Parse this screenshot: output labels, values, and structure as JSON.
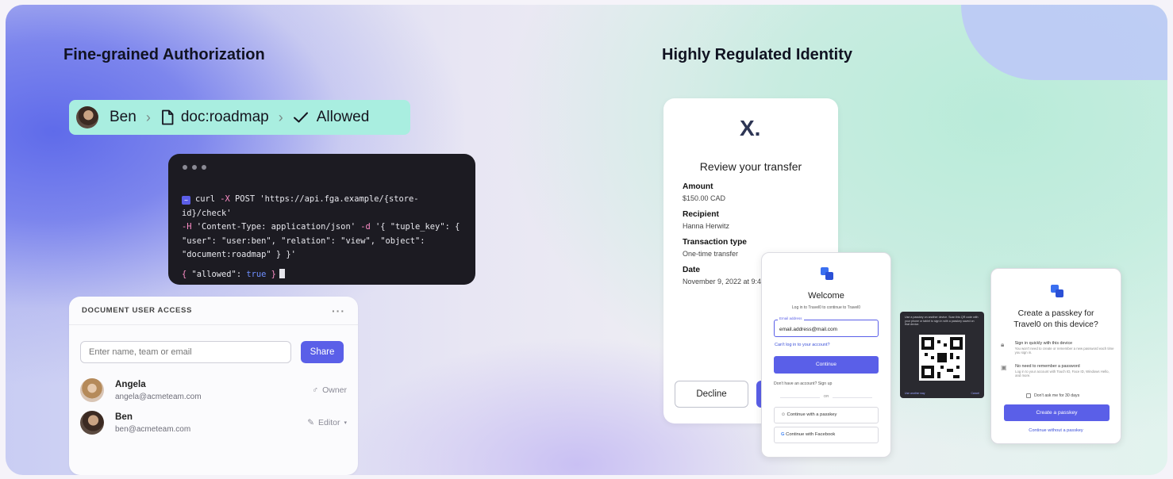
{
  "sections": {
    "left_title": "Fine-grained Authorization",
    "right_title": "Highly Regulated Identity"
  },
  "fga_chip": {
    "user": "Ben",
    "resource": "doc:roadmap",
    "result": "Allowed",
    "bg_color": "#a9eee0"
  },
  "terminal": {
    "prompt_icon": "~",
    "line1_cmd": "curl ",
    "line1_flag": "-X",
    "line1_rest": " POST 'https://api.fga.example/{store-id}/check'",
    "line2_flag": "-H",
    "line2_rest": " 'Content-Type: application/json' ",
    "line2_flag2": "-d",
    "line2_rest2": " '{ \"tuple_key\": {",
    "line3": "\"user\": \"user:ben\", \"relation\": \"view\", \"object\":",
    "line4": "\"document:roadmap\" } }'",
    "resp_open": "{ ",
    "resp_key": "\"allowed\": ",
    "resp_val": "true",
    "resp_close": " }"
  },
  "access_card": {
    "title": "DOCUMENT USER ACCESS",
    "more": "···",
    "search_placeholder": "Enter name, team or email",
    "share_label": "Share",
    "users": [
      {
        "name": "Angela",
        "email": "angela@acmeteam.com",
        "role": "Owner",
        "role_icon": "owner-icon"
      },
      {
        "name": "Ben",
        "email": "ben@acmeteam.com",
        "role": "Editor",
        "role_icon": "pencil-icon"
      }
    ]
  },
  "transfer_card": {
    "logo": "X.",
    "title": "Review your transfer",
    "fields": [
      {
        "label": "Amount",
        "value": "$150.00 CAD"
      },
      {
        "label": "Recipient",
        "value": "Hanna Herwitz"
      },
      {
        "label": "Transaction type",
        "value": "One-time transfer"
      },
      {
        "label": "Date",
        "value": "November 9, 2022 at 9:4"
      }
    ],
    "decline_label": "Decline"
  },
  "welcome_card": {
    "title": "Welcome",
    "subtitle": "Log in to Travel0 to continue to Travel0",
    "email_label": "Email address",
    "email_value": "email.address@mail.com",
    "cant_login": "Can't log in to your account?",
    "continue_label": "Continue",
    "signup_text": "Don't have an account? Sign up",
    "or_label": "OR",
    "passkey_label": "Continue with a passkey",
    "facebook_label": "Continue with Facebook"
  },
  "qr_card": {
    "text": "Use a passkey on another device. Scan this QR code with your phone or tablet to sign in with a passkey saved on that device.",
    "footer_left": "Use another way",
    "footer_right": "Cancel"
  },
  "passkey_card": {
    "title_line1": "Create a passkey for",
    "title_line2": "Travel0 on this device?",
    "row1_title": "Sign in quickly with this device",
    "row1_desc": "You won't need to create or remember a new password each time you sign in.",
    "row2_title": "No need to remember a password",
    "row2_desc": "Log in to your account with Touch ID, Face ID, Windows Hello, and more.",
    "remind_label": "Don't ask me for 30 days",
    "create_label": "Create a passkey",
    "skip_label": "Continue without a passkey"
  },
  "colors": {
    "accent": "#5a5fe8",
    "terminal_bg": "#1c1b22"
  }
}
